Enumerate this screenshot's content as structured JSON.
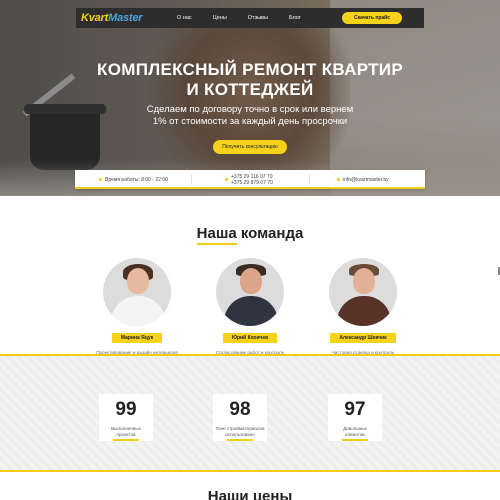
{
  "nav": {
    "logo_main": "Kvart",
    "logo_accent": "Master",
    "links": [
      "О нас",
      "Цены",
      "Отзывы",
      "Блог"
    ],
    "cta": "Скачать прайс"
  },
  "hero": {
    "title_line1": "КОМПЛЕКСНЫЙ РЕМОНТ КВАРТИР",
    "title_line2": "И КОТТЕДЖЕЙ",
    "subtitle_line1": "Сделаем по договору точно в срок или вернем",
    "subtitle_line2": "1% от стоимости за каждый день просрочки",
    "button": "Получить консультацию"
  },
  "info": {
    "hours": "Время работы: 8:00 - 22:00",
    "phone1": "+375 29 116 07 70",
    "phone2": "+375 29 879 07 70",
    "email": "info@kvartmaster.by"
  },
  "team": {
    "title_main": "Наша",
    "title_rest": " команда",
    "members": [
      {
        "name": "Марина Яцук",
        "role_line1": "Проектирование и дизайн интерьеров",
        "role_line2": ""
      },
      {
        "name": "Юрий Кохичев",
        "role_line1": "Согласование работ и контроль",
        "role_line2": "точности монтажа коммуникаций"
      },
      {
        "name": "Александр Шевчик",
        "role_line1": "Чистовая отделка и контроль",
        "role_line2": "соблюдения технологии"
      }
    ]
  },
  "stats": [
    {
      "value": "99",
      "label_line1": "Выполненных",
      "label_line2": "проектов"
    },
    {
      "value": "98",
      "label_line1": "Тонн стройматериалов",
      "label_line2": "использовано"
    },
    {
      "value": "97",
      "label_line1": "Довольных",
      "label_line2": "клиентов"
    }
  ],
  "prices": {
    "title": "Наши цены"
  },
  "colors": {
    "accent": "#f7d21b",
    "nav_bg": "#2d2d2d",
    "logo_accent": "#4aa3df"
  }
}
